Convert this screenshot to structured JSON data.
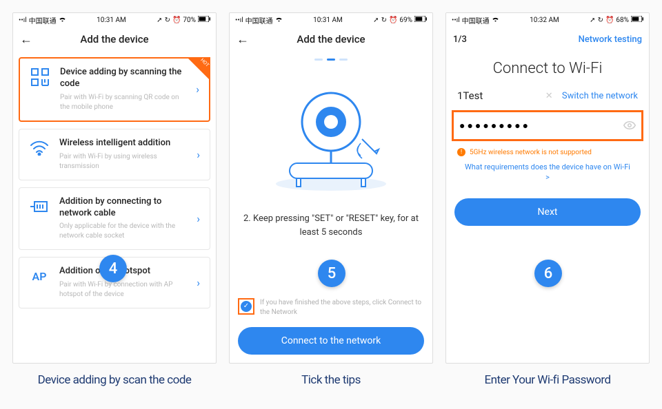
{
  "colors": {
    "accent": "#2e87ef",
    "highlight": "#ff6a13"
  },
  "screen1": {
    "status": {
      "carrier": "中国联通",
      "time": "10:31 AM",
      "battery": "70%"
    },
    "nav_title": "Add the device",
    "options": [
      {
        "title": "Device adding by scanning the code",
        "desc": "Pair with Wi-Fi by scanning QR code on the mobile phone",
        "icon": "qr-icon",
        "hot": true
      },
      {
        "title": "Wireless intelligent addition",
        "desc": "Pair with Wi-Fi by using wireless transmission",
        "icon": "wifi-icon",
        "hot": false
      },
      {
        "title": "Addition by connecting to network cable",
        "desc": "Only applicable for the device with the network cable socket",
        "icon": "ethernet-icon",
        "hot": false
      },
      {
        "title": "Addition of AP hotspot",
        "desc": "Pair with Wi-Fi by connection with AP hotspot of the device",
        "icon": "ap-icon",
        "hot": false
      }
    ],
    "badge": "4",
    "caption": "Device adding by scan the code"
  },
  "screen2": {
    "status": {
      "carrier": "中国联通",
      "time": "10:31 AM",
      "battery": "69%"
    },
    "nav_title": "Add the device",
    "instruction_num": "2.",
    "instruction": "Keep pressing \"SET\" or \"RESET\" key, for at least 5 seconds",
    "tick_label": "If you have finished the above steps, click Connect to the Network",
    "button": "Connect to the network",
    "badge": "5",
    "caption": "Tick the tips"
  },
  "screen3": {
    "status": {
      "carrier": "中国联通",
      "time": "10:32 AM",
      "battery": "68%"
    },
    "page_indicator": "1/3",
    "nav_right": "Network testing",
    "title": "Connect to Wi-Fi",
    "ssid": "1Test",
    "switch_label": "Switch the network",
    "password_masked": "●●●●●●●●●",
    "warning": "5GHz wireless network is not supported",
    "req_link": "What requirements does the device have on Wi-Fi >",
    "button": "Next",
    "badge": "6",
    "caption": "Enter Your Wi-fi Password"
  }
}
